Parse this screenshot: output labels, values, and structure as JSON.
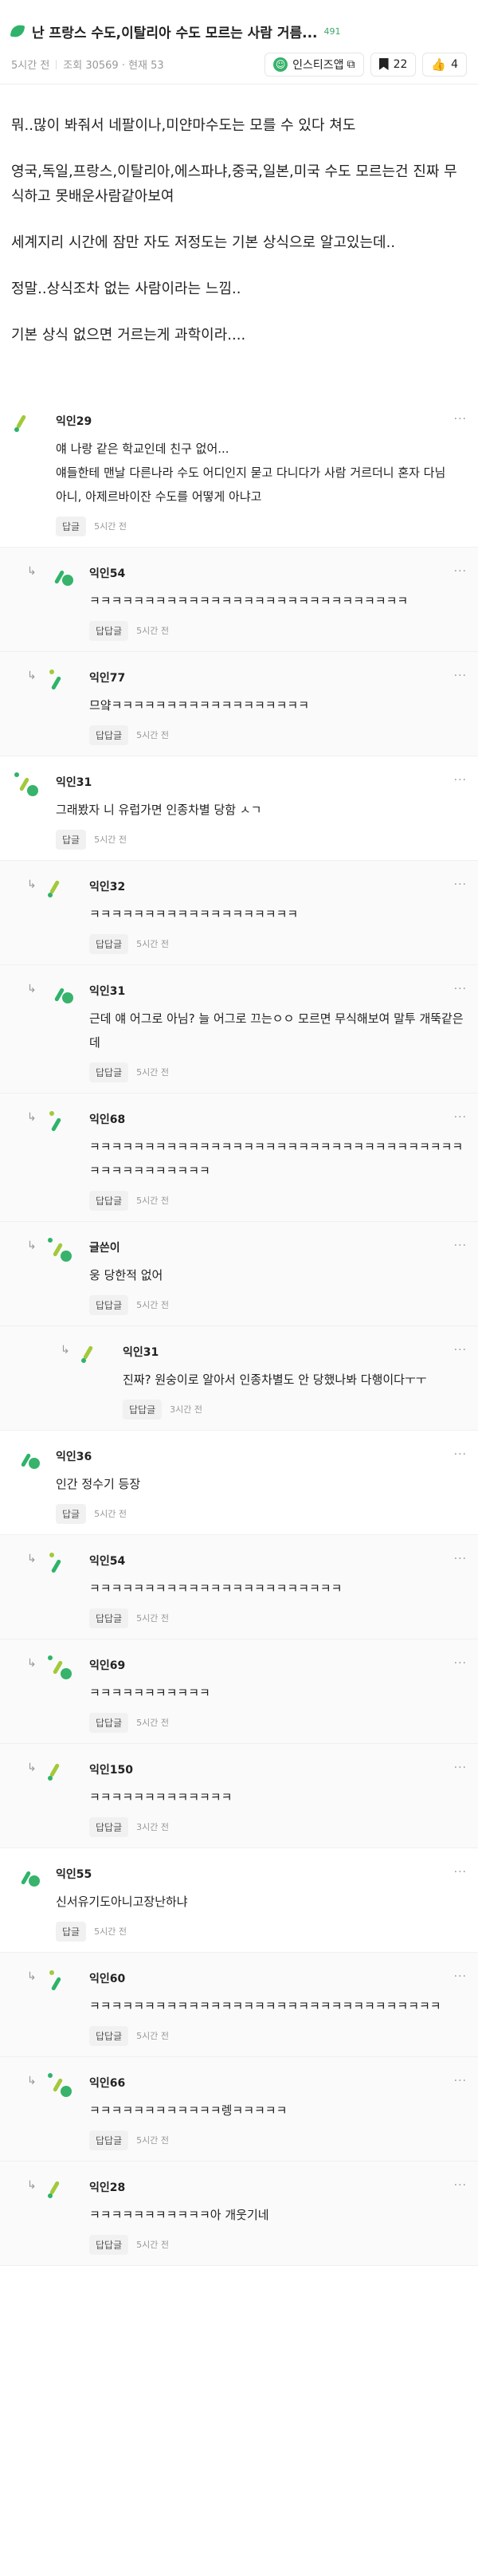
{
  "header": {
    "title": "난 프랑스 수도,이탈리아 수도 모르는 사람 거름...",
    "title_count": "491",
    "time": "5시간 전",
    "views": "조회 30569 · 현재 53",
    "insta_label": "인스티즈앱",
    "bookmark_count": "22",
    "like_count": "4"
  },
  "post": {
    "paragraphs": [
      "뭐..많이 봐줘서 네팔이나,미얀마수도는 모를 수 있다 쳐도",
      "영국,독일,프랑스,이탈리아,에스파냐,중국,일본,미국 수도 모르는건 진짜 무식하고 못배운사람같아보여",
      "세계지리 시간에 잠만 자도 저정도는 기본 상식으로 알고있는데..",
      "정말..상식조차 없는 사람이라는 느낌..",
      "기본 상식 없으면 거르는게 과학이라...."
    ]
  },
  "labels": {
    "reply": "답글",
    "reply_reply": "답답글",
    "more": "···",
    "reply_mark": "↳"
  },
  "colors": {
    "accent": "#2fb36b",
    "lime": "#a3c93a",
    "green": "#37b36b"
  },
  "comments": [
    {
      "level": 0,
      "author": "익인29",
      "text": "얘 나랑 같은 학교인데 친구 없어...\n얘들한테 맨날 다른나라 수도 어디인지 묻고 다니다가 사람 거르더니 혼자 다님\n아니, 아제르바이잔 수도를 어떻게 아냐고",
      "time": "5시간 전"
    },
    {
      "level": 1,
      "author": "익인54",
      "text": "ㅋㅋㅋㅋㅋㅋㅋㅋㅋㅋㅋㅋㅋㅋㅋㅋㅋㅋㅋㅋㅋㅋㅋㅋㅋㅋㅋㅋㅋ",
      "time": "5시간 전"
    },
    {
      "level": 1,
      "author": "익인77",
      "text": "므얔ㅋㅋㅋㅋㅋㅋㅋㅋㅋㅋㅋㅋㅋㅋㅋㅋㅋㅋ",
      "time": "5시간 전"
    },
    {
      "level": 0,
      "author": "익인31",
      "text": "그래봤자 니 유럽가면 인종차별 당함 ㅅㄱ",
      "time": "5시간 전"
    },
    {
      "level": 1,
      "author": "익인32",
      "text": "ㅋㅋㅋㅋㅋㅋㅋㅋㅋㅋㅋㅋㅋㅋㅋㅋㅋㅋㅋ",
      "time": "5시간 전"
    },
    {
      "level": 1,
      "author": "익인31",
      "text": "근데 얘 어그로 아님? 늘 어그로 끄는ㅇㅇ 모르면 무식해보여 말투 개뚝같은데",
      "time": "5시간 전"
    },
    {
      "level": 1,
      "author": "익인68",
      "text": "ㅋㅋㅋㅋㅋㅋㅋㅋㅋㅋㅋㅋㅋㅋㅋㅋㅋㅋㅋㅋㅋㅋㅋㅋㅋㅋㅋㅋㅋㅋㅋㅋㅋㅋㅋㅋㅋㅋㅋㅋㅋㅋㅋㅋㅋ",
      "time": "5시간 전"
    },
    {
      "level": 1,
      "author": "글쓴이",
      "text": "웅 당한적 없어",
      "time": "5시간 전"
    },
    {
      "level": 2,
      "author": "익인31",
      "text": "진짜? 원숭이로 알아서 인종차별도 안 당했나봐 다행이다ㅜㅜ",
      "time": "3시간 전"
    },
    {
      "level": 0,
      "author": "익인36",
      "text": "인간 정수기 등장",
      "time": "5시간 전"
    },
    {
      "level": 1,
      "author": "익인54",
      "text": "ㅋㅋㅋㅋㅋㅋㅋㅋㅋㅋㅋㅋㅋㅋㅋㅋㅋㅋㅋㅋㅋㅋㅋ",
      "time": "5시간 전"
    },
    {
      "level": 1,
      "author": "익인69",
      "text": "ㅋㅋㅋㅋㅋㅋㅋㅋㅋㅋㅋ",
      "time": "5시간 전"
    },
    {
      "level": 1,
      "author": "익인150",
      "text": "ㅋㅋㅋㅋㅋㅋㅋㅋㅋㅋㅋㅋㅋ",
      "time": "3시간 전"
    },
    {
      "level": 0,
      "author": "익인55",
      "text": "신서유기도아니고장난하냐",
      "time": "5시간 전"
    },
    {
      "level": 1,
      "author": "익인60",
      "text": "ㅋㅋㅋㅋㅋㅋㅋㅋㅋㅋㅋㅋㅋㅋㅋㅋㅋㅋㅋㅋㅋㅋㅋㅋㅋㅋㅋㅋㅋㅋㅋㅋ",
      "time": "5시간 전"
    },
    {
      "level": 1,
      "author": "익인66",
      "text": "ㅋㅋㅋㅋㅋㅋㅋㅋㅋㅋㅋㅋ렝ㅋㅋㅋㅋㅋ",
      "time": "5시간 전"
    },
    {
      "level": 1,
      "author": "익인28",
      "text": "ㅋㅋㅋㅋㅋㅋㅋㅋㅋㅋㅋ아 개웃기네",
      "time": "5시간 전"
    }
  ]
}
